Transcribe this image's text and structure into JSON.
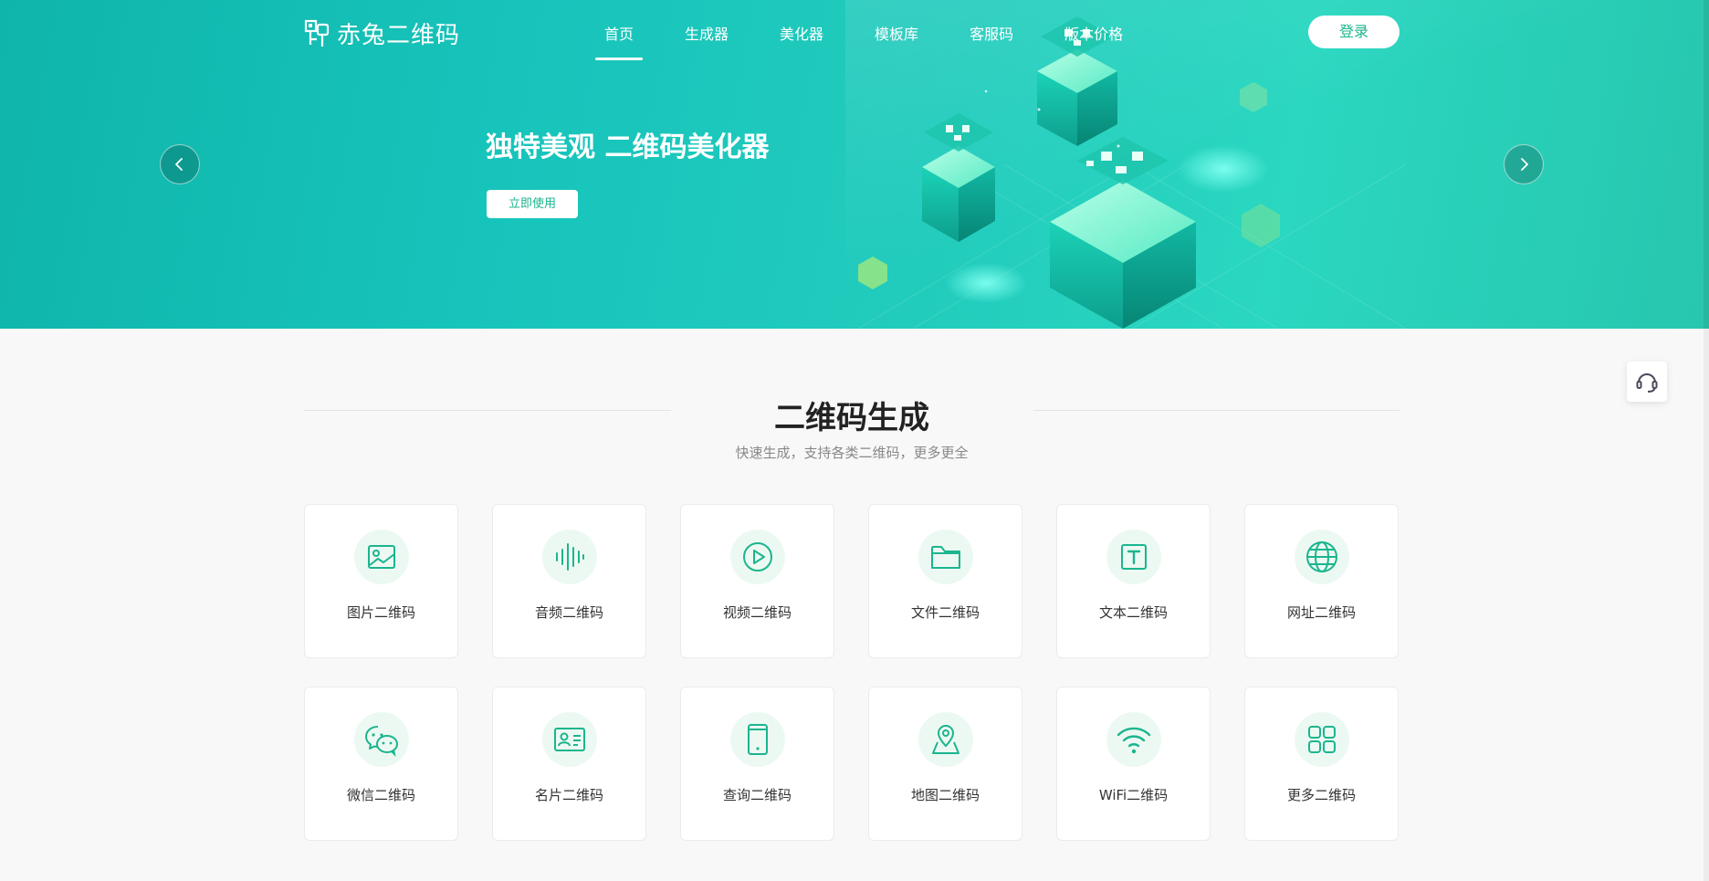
{
  "header": {
    "logo_text": "赤兔二维码",
    "nav": [
      {
        "label": "首页",
        "active": true
      },
      {
        "label": "生成器",
        "active": false
      },
      {
        "label": "美化器",
        "active": false
      },
      {
        "label": "模板库",
        "active": false
      },
      {
        "label": "客服码",
        "active": false
      },
      {
        "label": "版本价格",
        "active": false
      }
    ],
    "login_label": "登录"
  },
  "banner": {
    "title": "独特美观 二维码美化器",
    "cta_label": "立即使用",
    "prev_icon": "chevron-left-icon",
    "next_icon": "chevron-right-icon"
  },
  "floating": {
    "support_icon": "headset-icon"
  },
  "section": {
    "title": "二维码生成",
    "subtitle": "快速生成，支持各类二维码，更多更全",
    "cards": [
      {
        "label": "图片二维码",
        "icon": "image-icon"
      },
      {
        "label": "音频二维码",
        "icon": "audio-wave-icon"
      },
      {
        "label": "视频二维码",
        "icon": "play-icon"
      },
      {
        "label": "文件二维码",
        "icon": "folder-icon"
      },
      {
        "label": "文本二维码",
        "icon": "text-icon"
      },
      {
        "label": "网址二维码",
        "icon": "globe-icon"
      },
      {
        "label": "微信二维码",
        "icon": "wechat-icon"
      },
      {
        "label": "名片二维码",
        "icon": "id-card-icon"
      },
      {
        "label": "查询二维码",
        "icon": "tablet-icon"
      },
      {
        "label": "地图二维码",
        "icon": "map-pin-icon"
      },
      {
        "label": "WiFi二维码",
        "icon": "wifi-icon"
      },
      {
        "label": "更多二维码",
        "icon": "grid-icon"
      }
    ]
  },
  "colors": {
    "accent": "#1bb58e",
    "banner": "#17c4bb",
    "icon_bg": "#ecf9f2"
  }
}
